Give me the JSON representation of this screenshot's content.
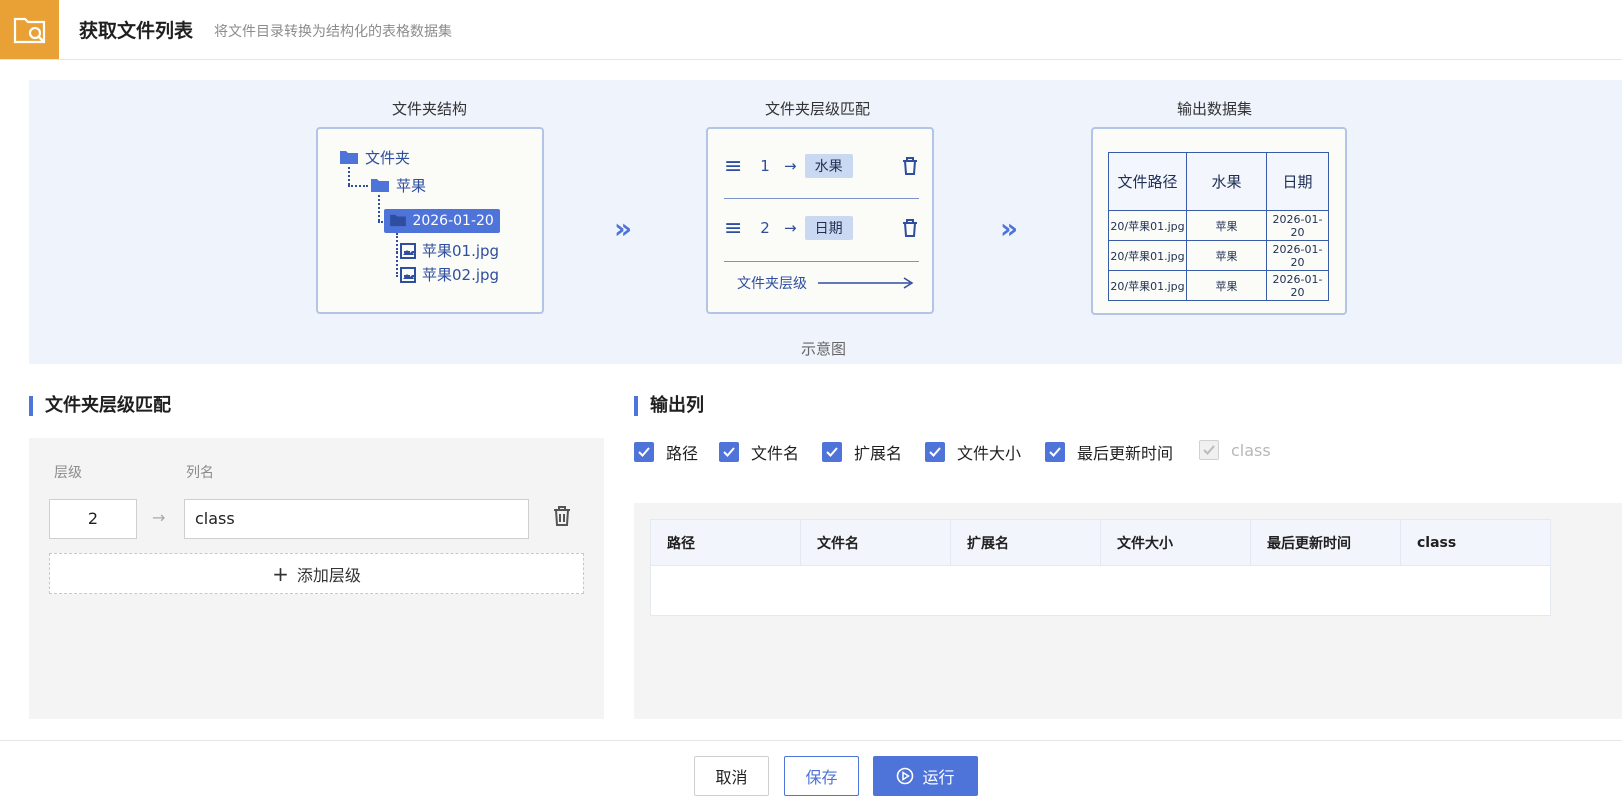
{
  "header": {
    "title": "获取文件列表",
    "subtitle": "将文件目录转换为结构化的表格数据集"
  },
  "diagram": {
    "panel1_title": "文件夹结构",
    "panel2_title": "文件夹层级匹配",
    "panel3_title": "输出数据集",
    "caption": "示意图",
    "tree": {
      "root": "文件夹",
      "child": "苹果",
      "selected": "2026-01-20",
      "file1": "苹果01.jpg",
      "file2": "苹果02.jpg"
    },
    "mapping": [
      {
        "level": "1",
        "tag": "水果"
      },
      {
        "level": "2",
        "tag": "日期"
      }
    ],
    "mapping_axis": "文件夹层级",
    "out_headers": [
      "文件路径",
      "水果",
      "日期"
    ],
    "out_rows": [
      [
        "20/苹果01.jpg",
        "苹果",
        "2026-01-20"
      ],
      [
        "20/苹果01.jpg",
        "苹果",
        "2026-01-20"
      ],
      [
        "20/苹果01.jpg",
        "苹果",
        "2026-01-20"
      ]
    ]
  },
  "left": {
    "title": "文件夹层级匹配",
    "label_level": "层级",
    "label_name": "列名",
    "level_value": "2",
    "name_value": "class",
    "add_label": "添加层级"
  },
  "right": {
    "title": "输出列",
    "checkboxes": [
      {
        "label": "路径",
        "checked": true
      },
      {
        "label": "文件名",
        "checked": true
      },
      {
        "label": "扩展名",
        "checked": true
      },
      {
        "label": "文件大小",
        "checked": true
      },
      {
        "label": "最后更新时间",
        "checked": true
      },
      {
        "label": "class",
        "checked": true,
        "disabled": true
      }
    ],
    "columns": [
      "路径",
      "文件名",
      "扩展名",
      "文件大小",
      "最后更新时间",
      "class"
    ]
  },
  "footer": {
    "cancel": "取消",
    "save": "保存",
    "run": "运行"
  },
  "colors": {
    "accent": "#4e73d9",
    "logo": "#e9a035"
  }
}
